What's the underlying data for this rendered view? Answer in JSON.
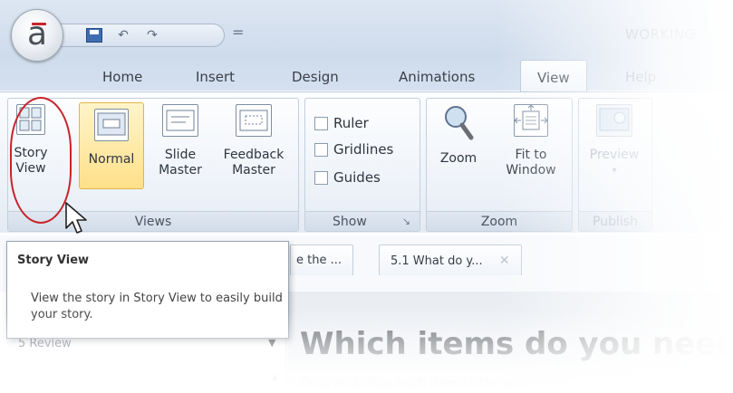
{
  "window": {
    "title": "WORKING"
  },
  "qat": {
    "undo_icon": "undo-icon",
    "redo_icon": "redo-icon",
    "customize": "="
  },
  "tabs": [
    {
      "label": "Home"
    },
    {
      "label": "Insert"
    },
    {
      "label": "Design"
    },
    {
      "label": "Animations"
    },
    {
      "label": "View"
    },
    {
      "label": "Help"
    }
  ],
  "ribbon": {
    "views": {
      "group_label": "Views",
      "story_view": {
        "line1": "Story",
        "line2": "View"
      },
      "normal": {
        "label": "Normal"
      },
      "slide_master": {
        "line1": "Slide",
        "line2": "Master"
      },
      "feedback_master": {
        "line1": "Feedback",
        "line2": "Master"
      }
    },
    "show": {
      "group_label": "Show",
      "ruler": "Ruler",
      "gridlines": "Gridlines",
      "guides": "Guides"
    },
    "zoom": {
      "group_label": "Zoom",
      "zoom": "Zoom",
      "fit_line1": "Fit to",
      "fit_line2": "Window"
    },
    "publish": {
      "group_label": "Publish",
      "preview": "Preview"
    }
  },
  "doc_tabs": [
    {
      "label": "e the ..."
    },
    {
      "label": "5.1 What do y...",
      "close": "✕"
    }
  ],
  "tooltip": {
    "title": "Story View",
    "body": "View the story in Story View to easily build your story."
  },
  "left_panel": {
    "item": "5 Review"
  },
  "slide": {
    "title": "Which items do you need",
    "subtitle": "Drag and drop each item to the appr..."
  },
  "colors": {
    "accent_red": "#c8232b",
    "highlight": "#ffe08a"
  }
}
